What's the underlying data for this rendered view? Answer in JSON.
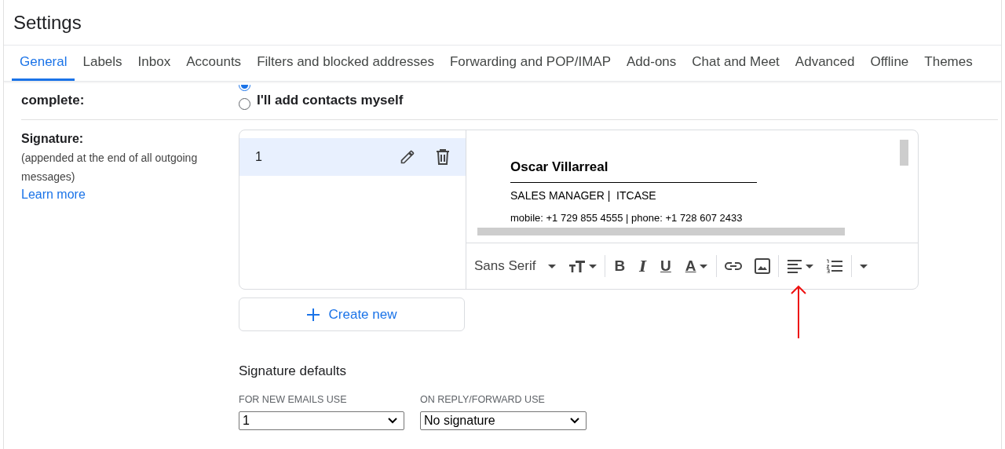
{
  "title": "Settings",
  "tabs": [
    {
      "label": "General",
      "selected": true
    },
    {
      "label": "Labels",
      "selected": false
    },
    {
      "label": "Inbox",
      "selected": false
    },
    {
      "label": "Accounts",
      "selected": false
    },
    {
      "label": "Filters and blocked addresses",
      "selected": false
    },
    {
      "label": "Forwarding and POP/IMAP",
      "selected": false
    },
    {
      "label": "Add-ons",
      "selected": false
    },
    {
      "label": "Chat and Meet",
      "selected": false
    },
    {
      "label": "Advanced",
      "selected": false
    },
    {
      "label": "Offline",
      "selected": false
    },
    {
      "label": "Themes",
      "selected": false
    }
  ],
  "contacts": {
    "label": "complete:",
    "options": [
      {
        "selected": true
      },
      {
        "label": "I'll add contacts myself",
        "selected": false
      }
    ]
  },
  "signature": {
    "label": "Signature:",
    "note": "(appended at the end of all outgoing messages)",
    "link": "Learn more",
    "items": [
      {
        "name": "1",
        "selected": true
      }
    ],
    "preview": {
      "name": "Oscar Villarreal",
      "role": "SALES MANAGER |  ITCASE",
      "contact": "mobile: +1 729 855 4555 | phone: +1 728 607 2433"
    },
    "toolbar": [
      {
        "kind": "font",
        "label": "Sans Serif"
      },
      {
        "kind": "size"
      },
      {
        "kind": "sep"
      },
      {
        "kind": "bold",
        "label": "B"
      },
      {
        "kind": "italic",
        "label": "I"
      },
      {
        "kind": "underline",
        "label": "U"
      },
      {
        "kind": "color",
        "label": "A"
      },
      {
        "kind": "sep"
      },
      {
        "kind": "link"
      },
      {
        "kind": "image"
      },
      {
        "kind": "sep"
      },
      {
        "kind": "align"
      },
      {
        "kind": "list"
      },
      {
        "kind": "sep"
      },
      {
        "kind": "more"
      }
    ],
    "create_button": "Create new",
    "defaults": {
      "title": "Signature defaults",
      "fields": [
        {
          "label": "FOR NEW EMAILS USE",
          "value": "1"
        },
        {
          "label": "ON REPLY/FORWARD USE",
          "value": "No signature"
        }
      ]
    }
  }
}
